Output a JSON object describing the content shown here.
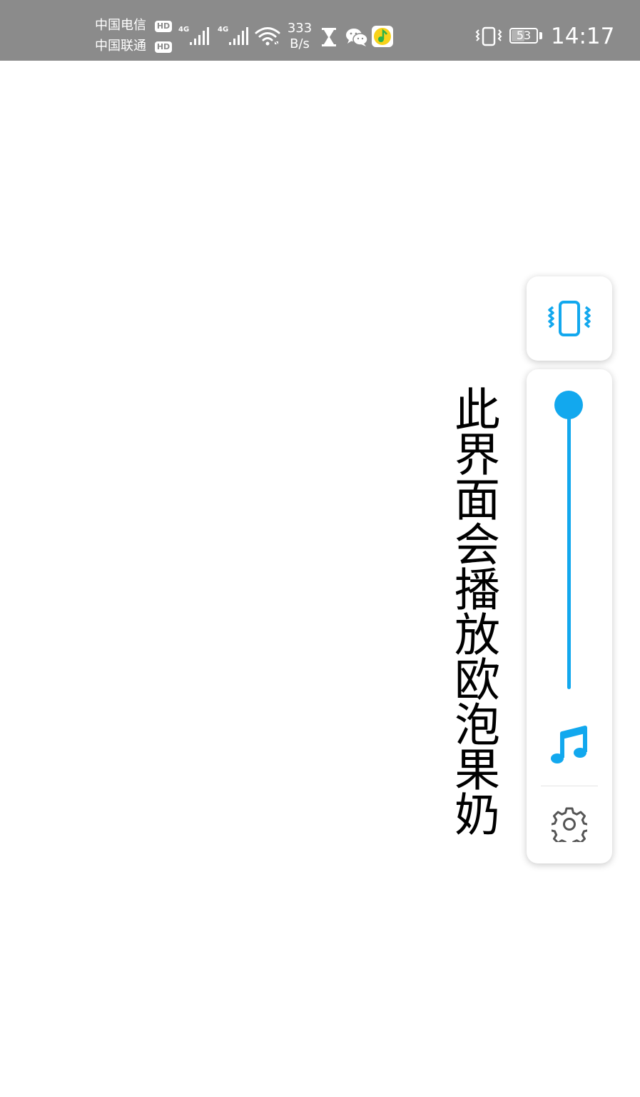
{
  "status_bar": {
    "carrier_1": "中国电信",
    "carrier_2": "中国联通",
    "hd_label": "HD",
    "network_gen": "4G",
    "net_speed_value": "333",
    "net_speed_unit": "B/s",
    "battery_percent": "53",
    "time": "14:17",
    "icons": [
      "signal-icon",
      "wifi-icon",
      "hourglass-icon",
      "wechat-icon",
      "qq-music-icon",
      "vibrate-icon",
      "battery-icon"
    ]
  },
  "main": {
    "vertical_text": "此界面会播放欧泡果奶"
  },
  "volume_panel": {
    "vibrate_icon": "vibrate-icon",
    "volume_level": 1.0,
    "stream_icon": "music-note-icon",
    "settings_icon": "gear-icon"
  },
  "colors": {
    "status_bar_bg": "#8b8b8b",
    "accent": "#12a8ee",
    "gear": "#555555",
    "qq_music_bg": "#f7d21a",
    "qq_music_note": "#2cb24a"
  }
}
